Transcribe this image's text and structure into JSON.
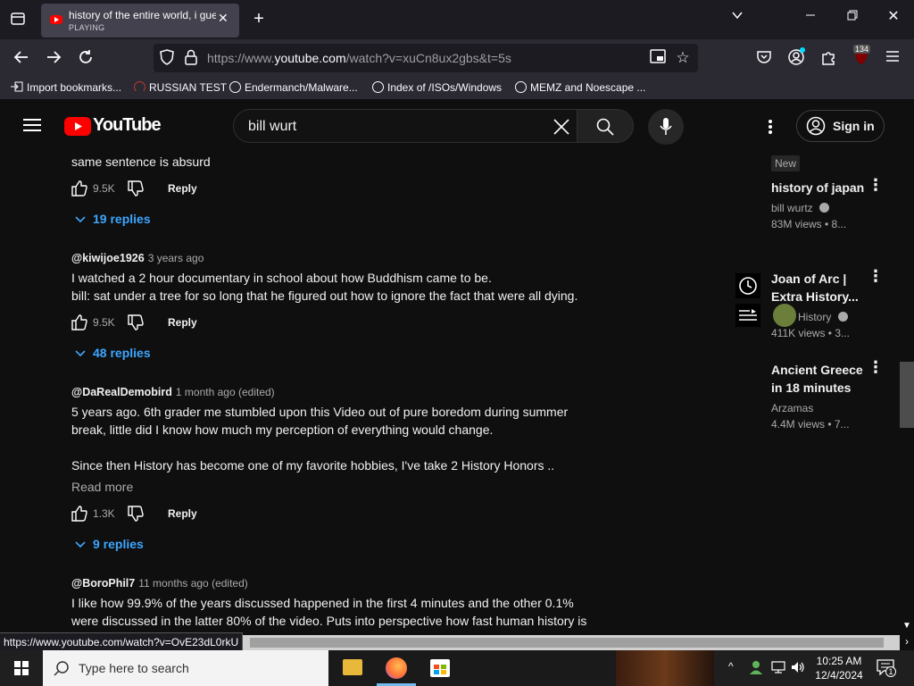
{
  "browser": {
    "tab_title": "history of the entire world, i guess",
    "tab_status": "PLAYING",
    "url_prefix": "https://www.",
    "url_domain": "youtube.com",
    "url_rest": "/watch?v=xuCn8ux2gbs&t=5s",
    "extension_badge": "134",
    "status_url": "https://www.youtube.com/watch?v=OvE23dL0rkU"
  },
  "bookmarks": [
    {
      "label": "Import bookmarks..."
    },
    {
      "label": "RUSSIAN TEST"
    },
    {
      "label": "Endermanch/Malware..."
    },
    {
      "label": "Index of /ISOs/Windows"
    },
    {
      "label": "MEMZ and Noescape ..."
    }
  ],
  "youtube": {
    "logo_text": "YouTube",
    "search_value": "bill wurt",
    "signin_label": "Sign in"
  },
  "comments": [
    {
      "text_lines": [
        "same sentence is absurd"
      ],
      "likes": "9.5K",
      "reply_label": "Reply",
      "replies": "19 replies"
    },
    {
      "author": "@kiwijoe1926",
      "ago": "3 years ago",
      "text_lines": [
        "I watched a 2 hour documentary in school about how Buddhism came to be.",
        "bill: sat under a tree for so long that he figured out how to ignore the fact that were all dying."
      ],
      "likes": "9.5K",
      "reply_label": "Reply",
      "replies": "48 replies"
    },
    {
      "author": "@DaRealDemobird",
      "ago": "1 month ago (edited)",
      "text_lines": [
        "5 years ago. 6th grader me stumbled upon this Video out of pure boredom during summer",
        "break, little did I know how much my perception of everything would change.",
        "Since then History has become one of my favorite hobbies, I've take 2 History Honors .."
      ],
      "read_more": "Read more",
      "likes": "1.3K",
      "reply_label": "Reply",
      "replies": "9 replies"
    },
    {
      "author": "@BoroPhil7",
      "ago": "11 months ago (edited)",
      "text_lines": [
        "I like how 99.9% of the years discussed happened in the first 4 minutes and the other 0.1%",
        "were discussed in the latter 80% of the video. Puts into perspective how fast human history is"
      ]
    }
  ],
  "sidebar": [
    {
      "badge": "New",
      "title_lines": [
        "history of japan"
      ],
      "channel": "bill wurtz",
      "stats": "83M views  • 8..."
    },
    {
      "title_lines": [
        "Joan of Arc |",
        "Extra History..."
      ],
      "channel": "History",
      "stats": "411K views  • 3..."
    },
    {
      "title_lines": [
        "Ancient Greece",
        "in 18 minutes"
      ],
      "channel": "Arzamas",
      "stats": "4.4M views  • 7..."
    }
  ],
  "taskbar": {
    "search_placeholder": "Type here to search",
    "time": "10:25 AM",
    "date": "12/4/2024",
    "notif_count": "1"
  },
  "colors": {
    "accent_link": "#3ea6ff",
    "youtube_red": "#ff0000"
  }
}
